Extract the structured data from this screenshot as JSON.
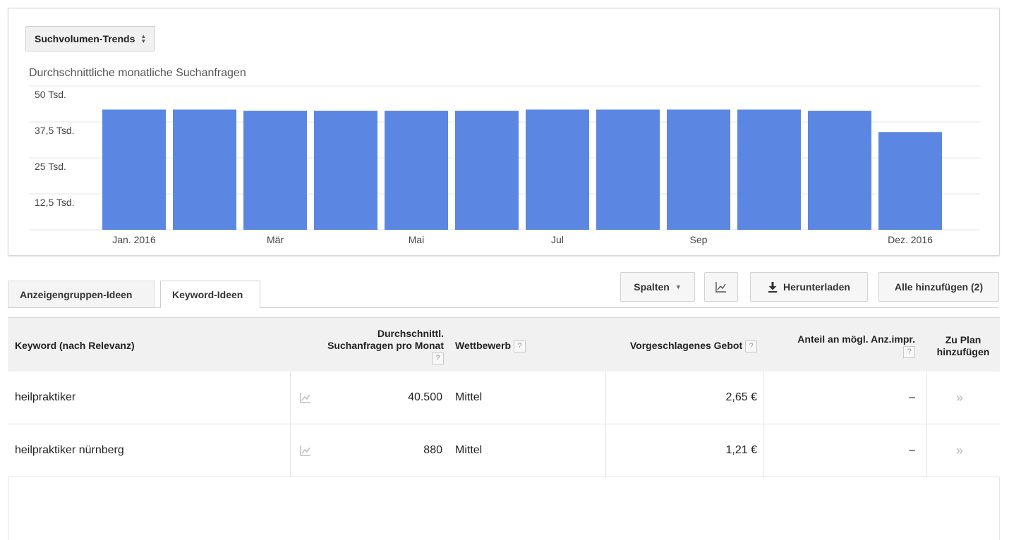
{
  "chart_selector": {
    "label": "Suchvolumen-Trends",
    "icon": "sort-updown-icon"
  },
  "chart_data": {
    "type": "bar",
    "title": "Durchschnittliche monatliche Suchanfragen",
    "categories": [
      "Jan. 2016",
      "Feb. 2016",
      "Mär 2016",
      "Apr. 2016",
      "Mai 2016",
      "Jun. 2016",
      "Jul 2016",
      "Aug. 2016",
      "Sep 2016",
      "Okt. 2016",
      "Nov. 2016",
      "Dez. 2016"
    ],
    "values": [
      41800,
      41800,
      41400,
      41400,
      41400,
      41400,
      41800,
      41800,
      41800,
      41800,
      41400,
      34000
    ],
    "x_tick_labels": [
      "Jan. 2016",
      "",
      "Mär",
      "",
      "Mai",
      "",
      "Jul",
      "",
      "Sep",
      "",
      "",
      "Dez. 2016"
    ],
    "y_ticks": [
      12500,
      25000,
      37500,
      50000
    ],
    "y_tick_labels": [
      "12,5 Tsd.",
      "25 Tsd.",
      "37,5 Tsd.",
      "50 Tsd."
    ],
    "ylim": [
      0,
      50000
    ],
    "grid": true,
    "bar_color": "#5b87e3"
  },
  "tabs": [
    {
      "label": "Anzeigengruppen-Ideen",
      "active": false
    },
    {
      "label": "Keyword-Ideen",
      "active": true
    }
  ],
  "toolbar": {
    "columns_label": "Spalten",
    "chart_icon": "line-chart-icon",
    "download_label": "Herunterladen",
    "download_icon": "download-icon",
    "add_all_label": "Alle hinzufügen (2)"
  },
  "table": {
    "headers": {
      "keyword": "Keyword (nach Relevanz)",
      "avg_searches_line1": "Durchschnittl.",
      "avg_searches_line2": "Suchanfragen pro Monat",
      "competition": "Wettbewerb",
      "suggested_bid": "Vorgeschlagenes Gebot",
      "impr_share": "Anteil an mögl. Anz.impr.",
      "add_to_plan_line1": "Zu Plan",
      "add_to_plan_line2": "hinzufügen",
      "help": "?"
    },
    "rows": [
      {
        "keyword": "heilpraktiker",
        "avg_searches": "40.500",
        "competition": "Mittel",
        "bid": "2,65 €",
        "impr_share": "–",
        "add": "»"
      },
      {
        "keyword": "heilpraktiker nürnberg",
        "avg_searches": "880",
        "competition": "Mittel",
        "bid": "1,21 €",
        "impr_share": "–",
        "add": "»"
      }
    ]
  }
}
